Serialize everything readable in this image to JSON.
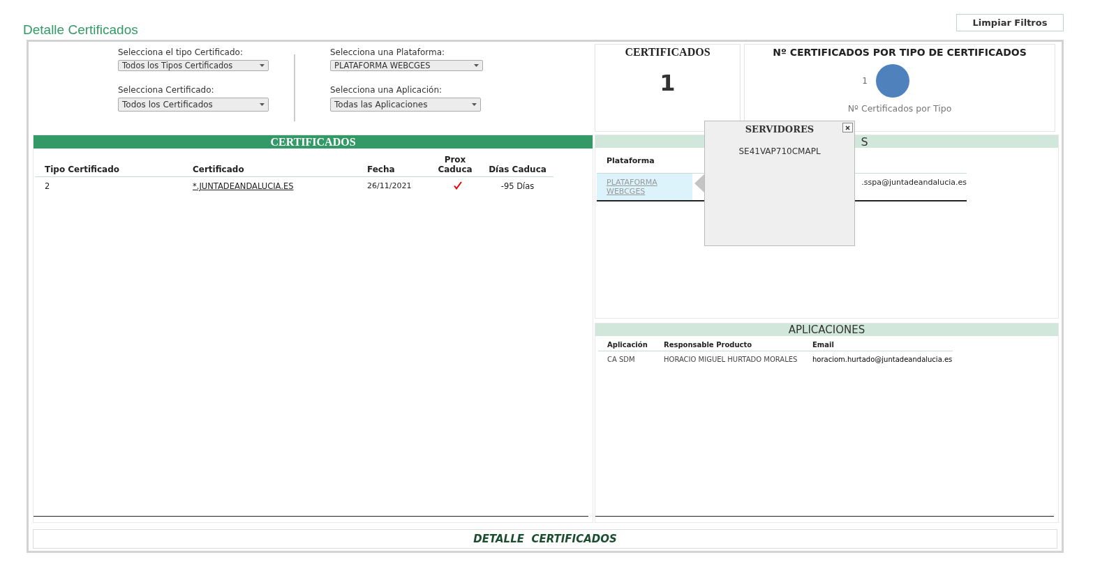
{
  "page_title": "Detalle Certificados",
  "clear_button": "Limpiar Filtros",
  "filters": [
    {
      "label": "Selecciona el tipo Certificado:",
      "value": "Todos los Tipos Certificados"
    },
    {
      "label": "Selecciona Certificado:",
      "value": "Todos los Certificados"
    },
    {
      "label": "Selecciona una Plataforma:",
      "value": "PLATAFORMA WEBCGES"
    },
    {
      "label": "Selecciona una Aplicación:",
      "value": "Todas las Aplicaciones"
    }
  ],
  "certificates": {
    "title": "CERTIFICADOS",
    "columns": [
      "Tipo Certificado",
      "Certificado",
      "Fecha",
      "Prox Caduca",
      "Días Caduca"
    ],
    "rows": [
      {
        "tipo": "2",
        "certificado": "*.JUNTADEANDALUCIA.ES",
        "fecha": "26/11/2021",
        "prox_caduca": true,
        "dias": "-95 Días"
      }
    ]
  },
  "count_card": {
    "title": "CERTIFICADOS",
    "value": "1"
  },
  "chart_card": {
    "title": "Nº CERTIFICADOS POR TIPO DE CERTIFICADOS",
    "chart_data": {
      "type": "pie",
      "title": "Nº Certificados por Tipo",
      "values": [
        1
      ],
      "data_labels": true
    }
  },
  "platforms": {
    "title_visible": "S",
    "columns": [
      "Plataforma"
    ],
    "rows": [
      {
        "plataforma": "PLATAFORMA WEBCGES",
        "email": ".sspa@juntadeandalucia.es",
        "selected": true
      }
    ]
  },
  "applications": {
    "title": "APLICACIONES",
    "columns": [
      "Aplicación",
      "Responsable Producto",
      "Email"
    ],
    "rows": [
      {
        "aplicacion": "CA SDM",
        "responsable": "HORACIO MIGUEL HURTADO MORALES",
        "email": "horaciom.hurtado@juntadeandalucia.es"
      }
    ]
  },
  "popup": {
    "title": "SERVIDORES",
    "items": [
      "SE41VAP710CMAPL"
    ]
  },
  "footer": "DETALLE  CERTIFICADOS"
}
